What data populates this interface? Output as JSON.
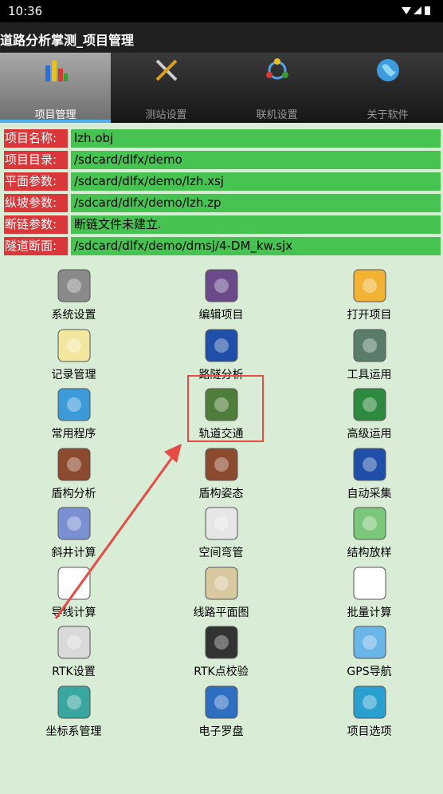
{
  "status": {
    "time": "10:36",
    "icons": "▾◢▮"
  },
  "app_title": "道路分析掌测_项目管理",
  "tabs": [
    {
      "label": "项目管理",
      "icon": "bar-chart-icon"
    },
    {
      "label": "测站设置",
      "icon": "tools-icon"
    },
    {
      "label": "联机设置",
      "icon": "network-icon"
    },
    {
      "label": "关于软件",
      "icon": "globe-icon"
    }
  ],
  "info": [
    {
      "key": "项目名称:",
      "value": "lzh.obj"
    },
    {
      "key": "项目目录:",
      "value": "/sdcard/dlfx/demo"
    },
    {
      "key": "平面参数:",
      "value": "/sdcard/dlfx/demo/lzh.xsj"
    },
    {
      "key": "纵坡参数:",
      "value": "/sdcard/dlfx/demo/lzh.zp"
    },
    {
      "key": "断链参数:",
      "value": "断链文件未建立."
    },
    {
      "key": "隧道断面:",
      "value": "/sdcard/dlfx/demo/dmsj/4-DM_kw.sjx"
    }
  ],
  "grid": [
    {
      "label": "系统设置",
      "icon": "settings-tools-icon",
      "color": "#8a8a8a"
    },
    {
      "label": "编辑项目",
      "icon": "users-icon",
      "color": "#6b4a8a"
    },
    {
      "label": "打开项目",
      "icon": "folder-icon",
      "color": "#f2b233"
    },
    {
      "label": "记录管理",
      "icon": "notepad-icon",
      "color": "#f3e7a0"
    },
    {
      "label": "路隧分析",
      "icon": "shell-icon",
      "color": "#1f4fa8"
    },
    {
      "label": "工具运用",
      "icon": "protractor-icon",
      "color": "#5a7d6a"
    },
    {
      "label": "常用程序",
      "icon": "apps-icon",
      "color": "#3d9ad8"
    },
    {
      "label": "轨道交通",
      "icon": "road-icon",
      "color": "#4f7d3a"
    },
    {
      "label": "高级运用",
      "icon": "area-chart-icon",
      "color": "#2e8a3e"
    },
    {
      "label": "盾构分析",
      "icon": "tunnel-icon",
      "color": "#8c4a2e"
    },
    {
      "label": "盾构姿态",
      "icon": "tunnel-icon",
      "color": "#8c4a2e"
    },
    {
      "label": "自动采集",
      "icon": "shell-icon",
      "color": "#1f4fa8"
    },
    {
      "label": "斜井计算",
      "icon": "curve-chart-icon",
      "color": "#7b8fd3"
    },
    {
      "label": "空间弯管",
      "icon": "axis-3d-icon",
      "color": "#e6e6e6"
    },
    {
      "label": "结构放样",
      "icon": "cad-icon",
      "color": "#7bc87a"
    },
    {
      "label": "导线计算",
      "icon": "line-graph-icon",
      "color": "#ffffff"
    },
    {
      "label": "线路平面图",
      "icon": "map-icon",
      "color": "#d8c9a0"
    },
    {
      "label": "批量计算",
      "icon": "calculator-icon",
      "color": "#ffffff"
    },
    {
      "label": "RTK设置",
      "icon": "gps-receiver-icon",
      "color": "#d9d9d9"
    },
    {
      "label": "RTK点校验",
      "icon": "route-pin-icon",
      "color": "#333333"
    },
    {
      "label": "GPS导航",
      "icon": "maps-icon",
      "color": "#6ab6e8"
    },
    {
      "label": "坐标系管理",
      "icon": "globe-grid-icon",
      "color": "#3aa6a0"
    },
    {
      "label": "电子罗盘",
      "icon": "compass-icon",
      "color": "#2e6fc2"
    },
    {
      "label": "项目选项",
      "icon": "gear-icon",
      "color": "#2aa0d0"
    }
  ],
  "accent": "#4db1ef",
  "key_bg": "#d9373a",
  "value_bg": "#46c350"
}
